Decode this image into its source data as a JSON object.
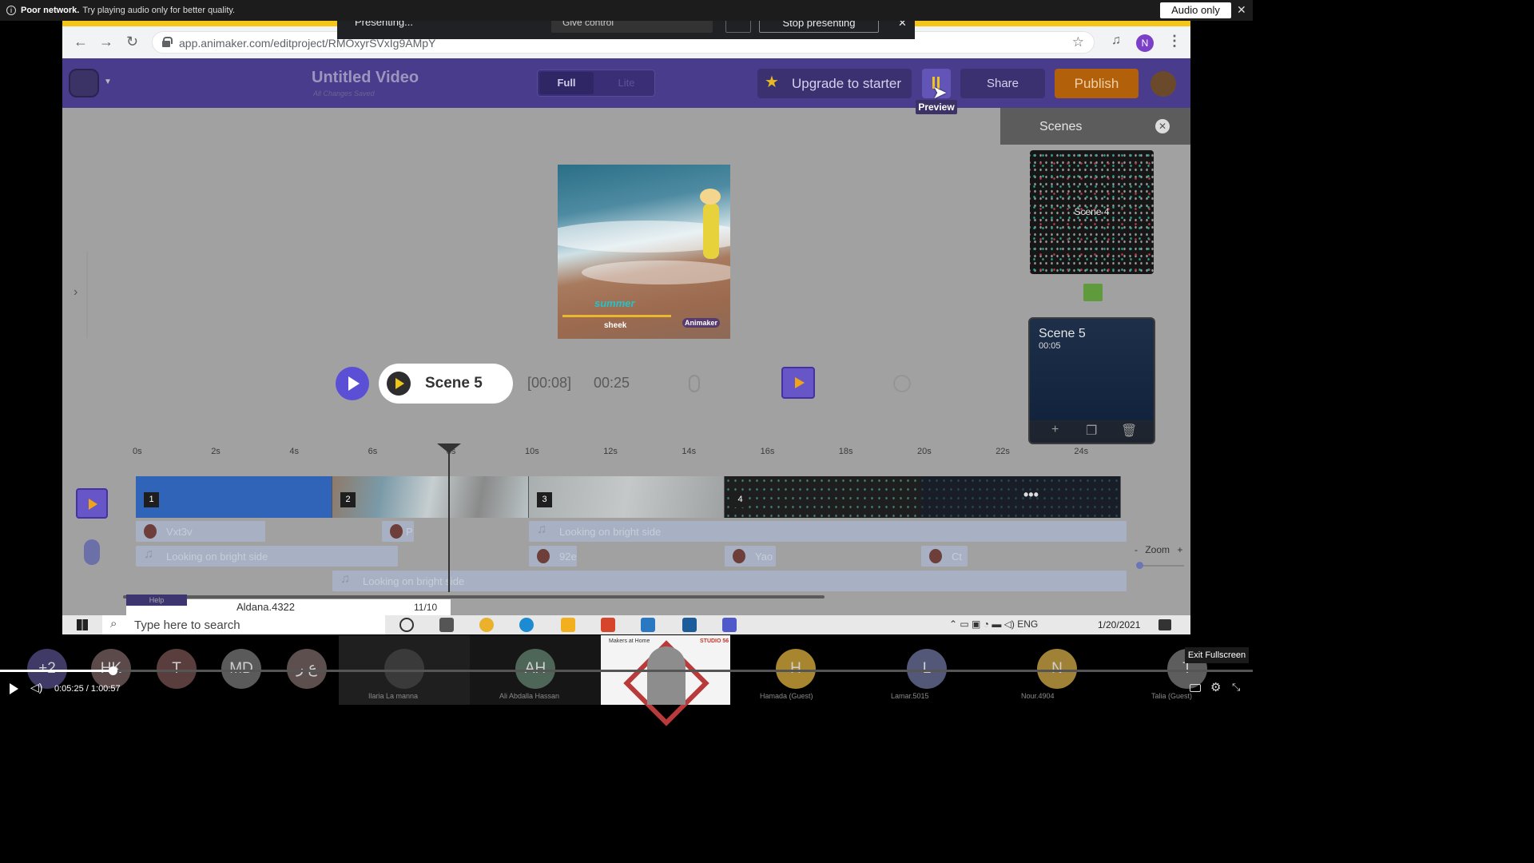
{
  "notice": {
    "bold": "Poor network.",
    "text": "Try playing audio only for better quality.",
    "audio_only": "Audio only",
    "close": "✕"
  },
  "presenting": {
    "status": "Presenting...",
    "give_control": "Give control",
    "stop": "Stop presenting",
    "close": "✕"
  },
  "browser": {
    "url": "app.animaker.com/editproject/RMOxyrSVxIg9AMpY",
    "profile_initial": "N"
  },
  "app": {
    "project_title": "Untitled Video",
    "save_status": "All Changes Saved",
    "mode_full": "Full",
    "mode_lite": "Lite",
    "upgrade": "Upgrade to starter",
    "preview_tooltip": "Preview",
    "share": "Share",
    "publish": "Publish"
  },
  "canvas": {
    "text_summer": "summer",
    "text_sheek": "sheek",
    "watermark": "Animaker"
  },
  "player": {
    "scene_name": "Scene 5",
    "current_time": "[00:08]",
    "total_time": "00:25"
  },
  "scenes_panel": {
    "title": "Scenes",
    "scene4_label": "Scene 4",
    "scene5_label": "Scene 5",
    "scene5_duration": "00:05"
  },
  "timeline": {
    "ticks": [
      "0s",
      "2s",
      "4s",
      "6s",
      "8s",
      "10s",
      "12s",
      "14s",
      "16s",
      "18s",
      "20s",
      "22s",
      "24s"
    ],
    "tracks": [
      "1",
      "2",
      "3",
      "4"
    ],
    "lanes": {
      "a1": "Vxt3v",
      "a2": "P",
      "a3": "Looking on bright side",
      "b1": "Looking on bright side",
      "b2": "92e",
      "b3": "Yao",
      "b4": "Ct",
      "c1": "Looking on bright side"
    },
    "zoom_label": "Zoom",
    "zoom_minus": "-",
    "zoom_plus": "+"
  },
  "chat": {
    "help": "Help",
    "name": "Aldana.4322",
    "count": "11/10"
  },
  "taskbar": {
    "search_placeholder": "Type here to search",
    "lang": "ENG",
    "date": "1/20/2021"
  },
  "meeting": {
    "participants": [
      {
        "initials": "+2",
        "name": ""
      },
      {
        "initials": "HK",
        "name": ""
      },
      {
        "initials": "T",
        "name": ""
      },
      {
        "initials": "MD",
        "name": ""
      },
      {
        "initials": "ع ر",
        "name": ""
      },
      {
        "initials": "",
        "name": "Ilaria La manna"
      },
      {
        "initials": "AH",
        "name": "Ali Abdalla Hassan"
      },
      {
        "initials": "",
        "name": ""
      },
      {
        "initials": "H",
        "name": "Hamada (Guest)"
      },
      {
        "initials": "L",
        "name": "Lamar.5015"
      },
      {
        "initials": "N",
        "name": "Nour.4904"
      },
      {
        "initials": "T",
        "name": "Talia (Guest)"
      }
    ],
    "video_tile_left": "Makers at Home",
    "video_tile_right": "STUDIO 56",
    "exit_fullscreen": "Exit Fullscreen",
    "time_current": "0:05:25",
    "time_sep": "/",
    "time_total": "1:00:57",
    "playback_progress": 0.09
  },
  "colors": {
    "brand_purple": "#4a3c8c",
    "publish_orange": "#b3600a",
    "accent_yellow": "#f0c419"
  }
}
